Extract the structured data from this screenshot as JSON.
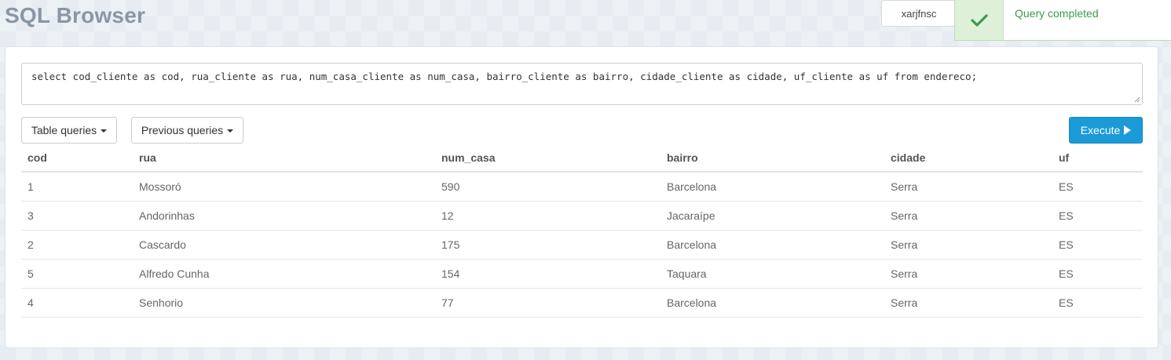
{
  "header": {
    "title": "SQL Browser",
    "user": "xarjfnsc"
  },
  "toast": {
    "message": "Query completed",
    "icon": "check-icon",
    "color": "#3c9b4a"
  },
  "query": {
    "text": "select cod_cliente as cod, rua_cliente as rua, num_casa_cliente as num_casa, bairro_cliente as bairro, cidade_cliente as cidade, uf_cliente as uf from endereco;"
  },
  "toolbar": {
    "table_queries_label": "Table queries",
    "previous_queries_label": "Previous queries",
    "execute_label": "Execute",
    "execute_color": "#1a9bd8"
  },
  "results": {
    "columns": [
      "cod",
      "rua",
      "num_casa",
      "bairro",
      "cidade",
      "uf"
    ],
    "rows": [
      [
        "1",
        "Mossoró",
        "590",
        "Barcelona",
        "Serra",
        "ES"
      ],
      [
        "3",
        "Andorinhas",
        "12",
        "Jacaraípe",
        "Serra",
        "ES"
      ],
      [
        "2",
        "Cascardo",
        "175",
        "Barcelona",
        "Serra",
        "ES"
      ],
      [
        "5",
        "Alfredo Cunha",
        "154",
        "Taquara",
        "Serra",
        "ES"
      ],
      [
        "4",
        "Senhorio",
        "77",
        "Barcelona",
        "Serra",
        "ES"
      ]
    ]
  }
}
